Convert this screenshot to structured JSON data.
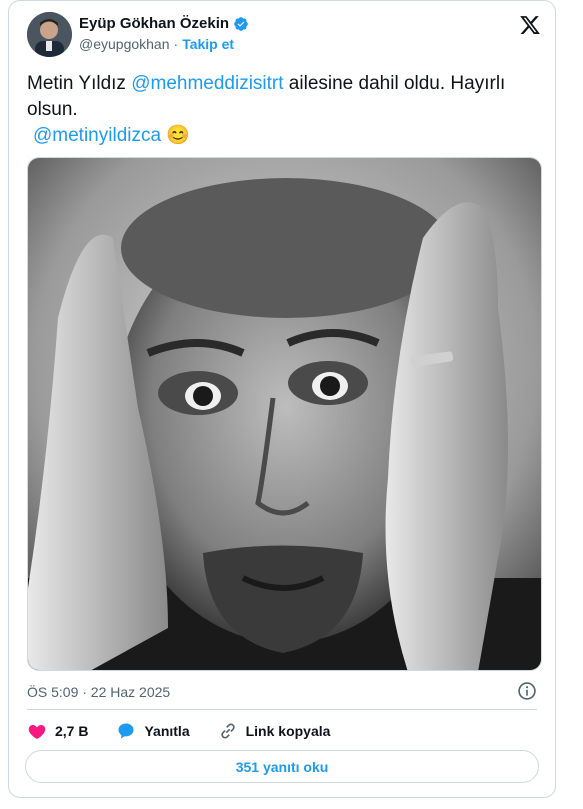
{
  "author": {
    "name": "Eyüp Gökhan Özekin",
    "handle": "@eyupgokhan",
    "separator": "·",
    "follow_label": "Takip et"
  },
  "tweet": {
    "text_before": "Metin Yıldız ",
    "mention1": "@mehmeddizisitrt",
    "text_after": " ailesine dahil oldu. Hayırlı olsun.",
    "mention2": "@metinyildizca",
    "emoji": "😊"
  },
  "meta": {
    "timestamp": "ÖS 5:09 · 22 Haz 2025"
  },
  "actions": {
    "likes": "2,7 B",
    "reply_label": "Yanıtla",
    "copy_link_label": "Link kopyala"
  },
  "replies_button": "351 yanıtı oku",
  "icons": {
    "verified": "verified-badge-icon",
    "logo": "x-logo-icon",
    "info": "info-icon",
    "like": "heart-icon",
    "reply": "reply-bubble-icon",
    "link": "link-icon"
  },
  "colors": {
    "accent": "#1d9bf0",
    "like": "#f91880",
    "text": "#0f1419",
    "muted": "#536471",
    "border": "#cfd9de"
  }
}
